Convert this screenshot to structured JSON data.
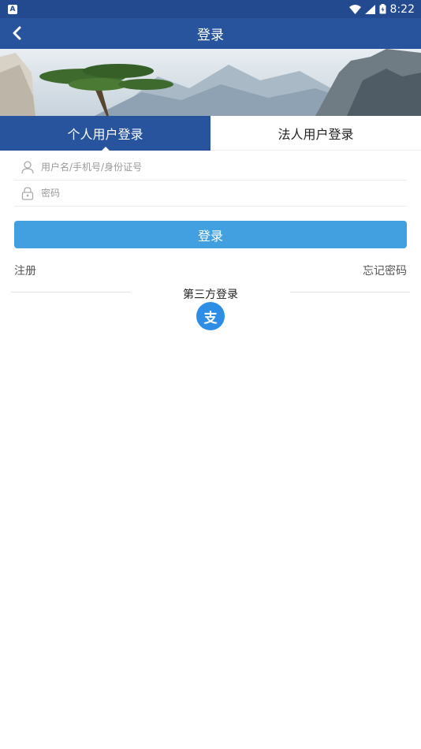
{
  "status_bar": {
    "time": "8:22"
  },
  "header": {
    "title": "登录"
  },
  "tabs": [
    {
      "label": "个人用户登录",
      "active": true
    },
    {
      "label": "法人用户登录",
      "active": false
    }
  ],
  "form": {
    "username_placeholder": "用户名/手机号/身份证号",
    "password_placeholder": "密码",
    "login_label": "登录"
  },
  "links": {
    "register": "注册",
    "forgot": "忘记密码"
  },
  "third_party": {
    "title": "第三方登录",
    "alipay_glyph": "支"
  },
  "colors": {
    "header": "#27549c",
    "status": "#23498f",
    "button": "#42a0e0",
    "alipay": "#2e8ee6"
  }
}
